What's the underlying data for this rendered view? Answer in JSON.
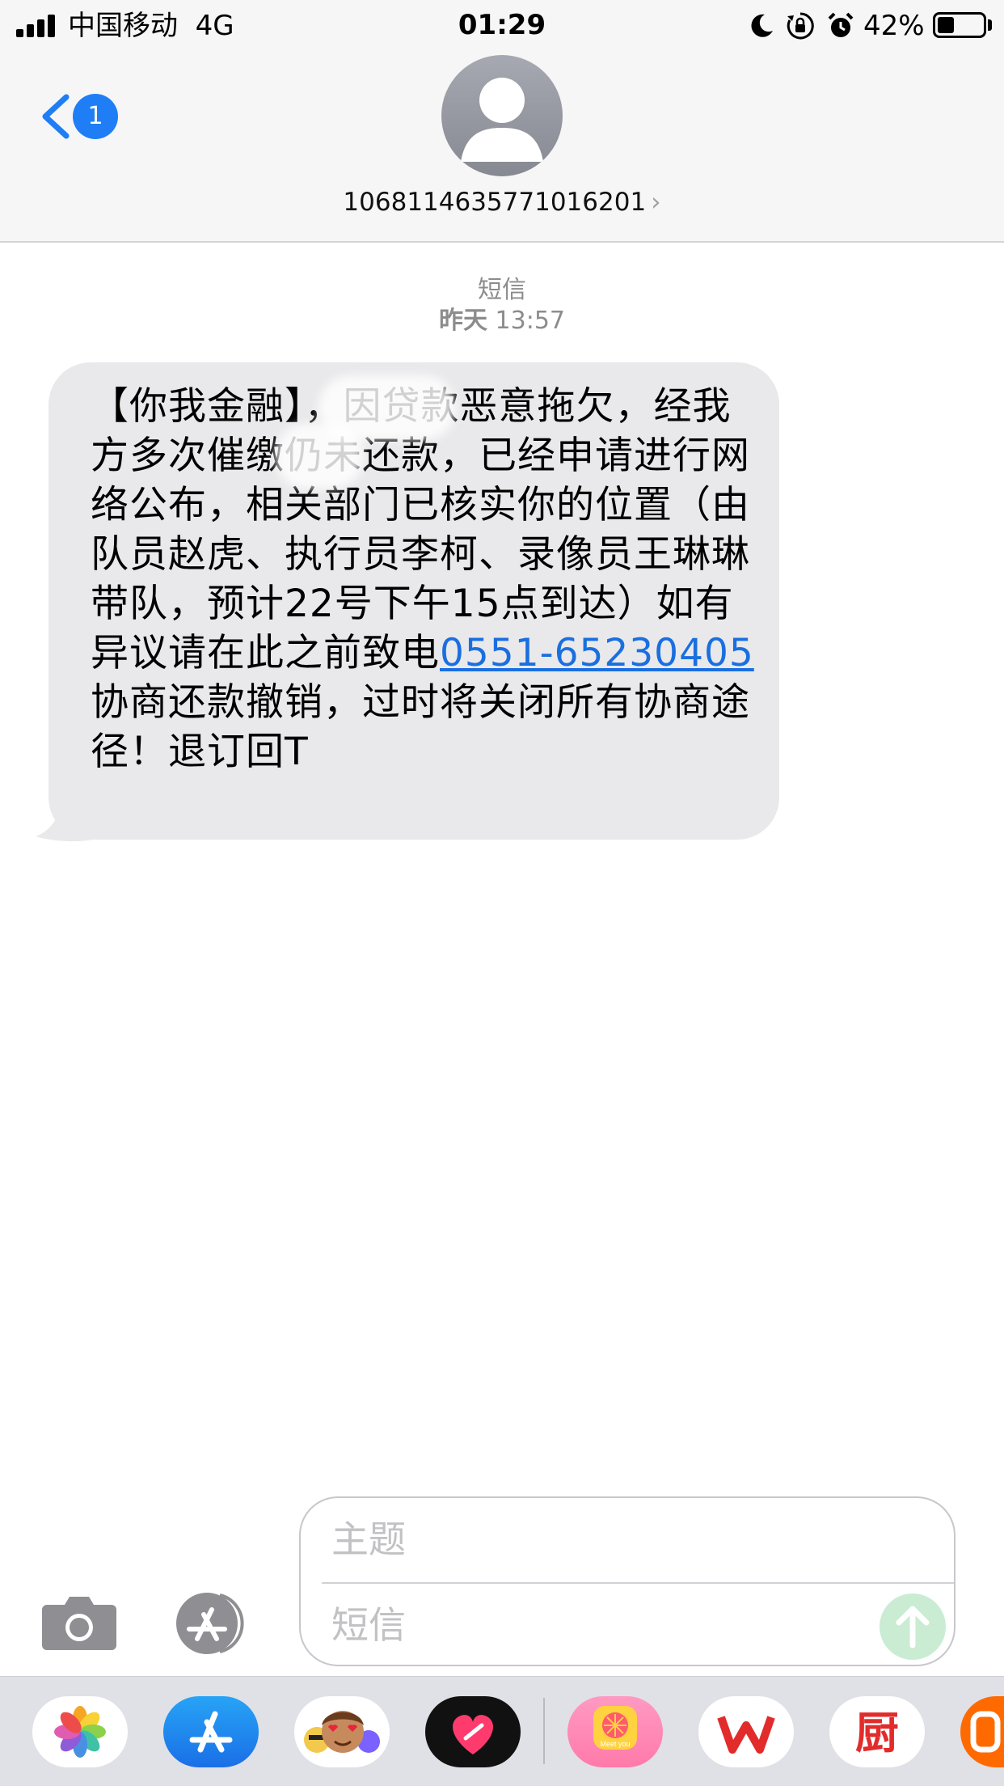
{
  "status_bar": {
    "carrier": "中国移动",
    "network": "4G",
    "time": "01:29",
    "battery_percent_label": "42%",
    "battery_level": 0.42,
    "icons": [
      "signal-icon",
      "moon-icon",
      "orientation-lock-icon",
      "alarm-icon",
      "battery-icon"
    ]
  },
  "header": {
    "back_badge_count": "1",
    "contact_number": "1068114635771016201",
    "contact_chevron": "›"
  },
  "thread": {
    "service_label": "短信",
    "day_label": "昨天",
    "time_label": "13:57"
  },
  "message": {
    "part1": "【你我金融】",
    "part2": "，因贷款恶意拖欠，经我方多次催缴仍未还款，已经申请进行网络公布，相关部门已核实你的位置（由队员赵虎、执行员李柯、录像员王琳琳带队，预计22号下午15点到达）如有异议请在此之前致电",
    "phone_link": "0551-65230405",
    "part3": "协商还款撤销，过时将关闭所有协商途径！退订回T"
  },
  "compose": {
    "subject_placeholder": "主题",
    "message_placeholder": "短信"
  },
  "colors": {
    "accent": "#1f7ef5",
    "bubble": "#e9e9eb",
    "link": "#1a6fe0",
    "send_disabled": "#c9ecd3"
  },
  "app_drawer": {
    "apps": [
      "photos-app-icon",
      "app-store-app-icon",
      "memoji-app-icon",
      "heart-app-icon",
      "meet-you-app-icon",
      "wps-app-icon",
      "kitchen-app-icon",
      "orange-app-icon"
    ],
    "meet_you_label": "Meet you",
    "kitchen_label": "厨"
  }
}
